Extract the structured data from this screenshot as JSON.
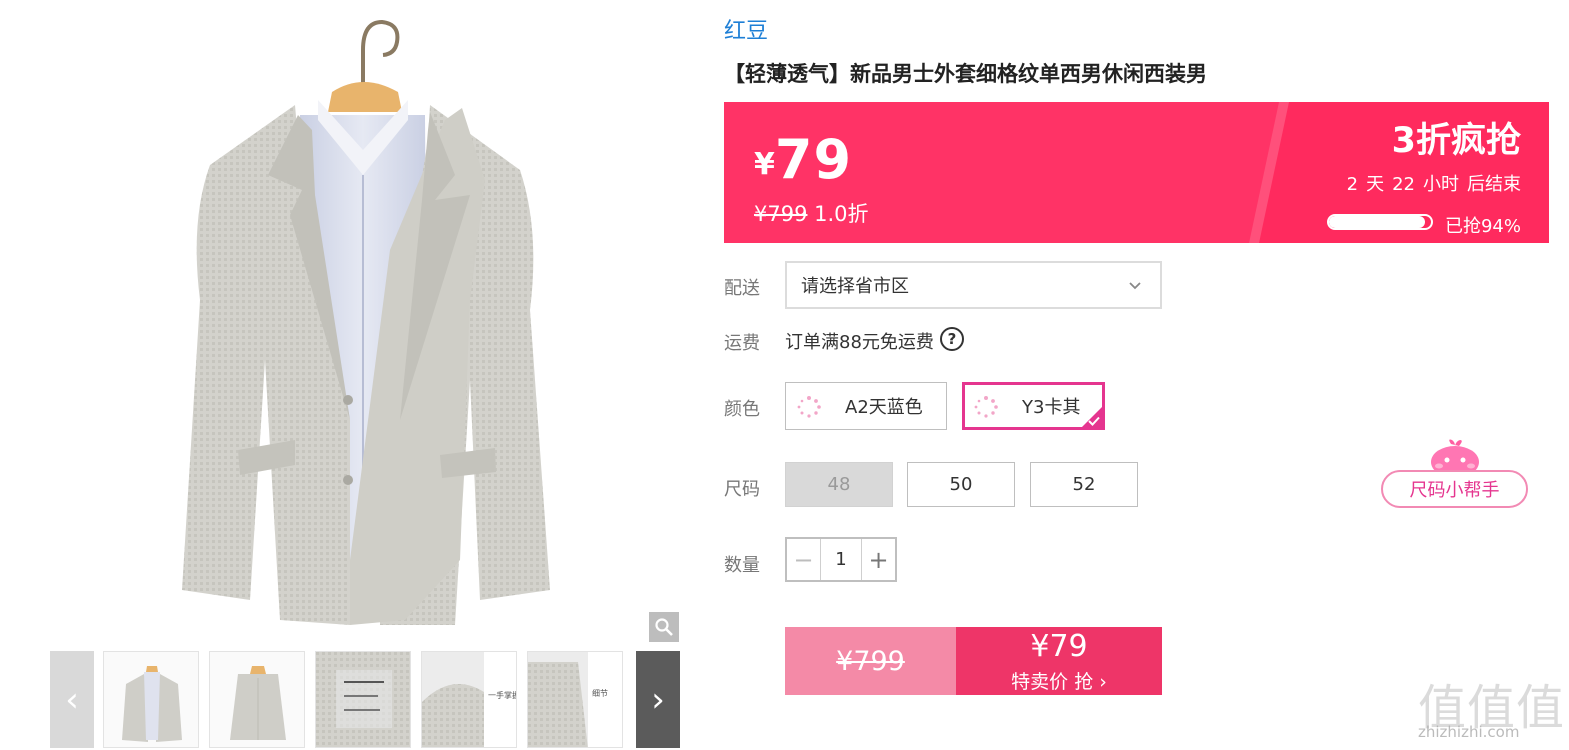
{
  "product": {
    "brand": "红豆",
    "title": "【轻薄透气】新品男士外套细格纹单西男休闲西装男"
  },
  "promo": {
    "currency": "¥",
    "price": "79",
    "original_price": "¥799",
    "discount_text": "1.0折",
    "label": "3折疯抢",
    "countdown": {
      "days": "2",
      "days_unit": "天",
      "hours": "22",
      "hours_unit": "小时",
      "suffix": "后结束"
    },
    "sold_percent": 94,
    "sold_text": "已抢94%",
    "accent_color": "#ff3366"
  },
  "delivery": {
    "label": "配送",
    "select_value": "请选择省市区"
  },
  "shipping": {
    "label": "运费",
    "text": "订单满88元免运费",
    "help_glyph": "?"
  },
  "color": {
    "label": "颜色",
    "options": [
      {
        "label": "A2天蓝色",
        "selected": false
      },
      {
        "label": "Y3卡其",
        "selected": true
      }
    ],
    "selected_color": "#e5358f"
  },
  "size": {
    "label": "尺码",
    "options": [
      {
        "label": "48",
        "disabled": true
      },
      {
        "label": "50",
        "disabled": false
      },
      {
        "label": "52",
        "disabled": false
      }
    ],
    "helper_label": "尺码小帮手"
  },
  "quantity": {
    "label": "数量",
    "value": "1",
    "minus": "−",
    "plus": "+"
  },
  "buy": {
    "original_price": "¥799",
    "price": "¥79",
    "action_label": "特卖价 抢 ›"
  },
  "gallery": {
    "prev_glyph": "‹",
    "next_glyph": "›",
    "zoom_icon": "magnifier-icon",
    "thumb_texts": [
      "一手掌握",
      "细节"
    ]
  },
  "watermark": {
    "glyphs": "值值值",
    "url": "zhizhizhi.com"
  }
}
